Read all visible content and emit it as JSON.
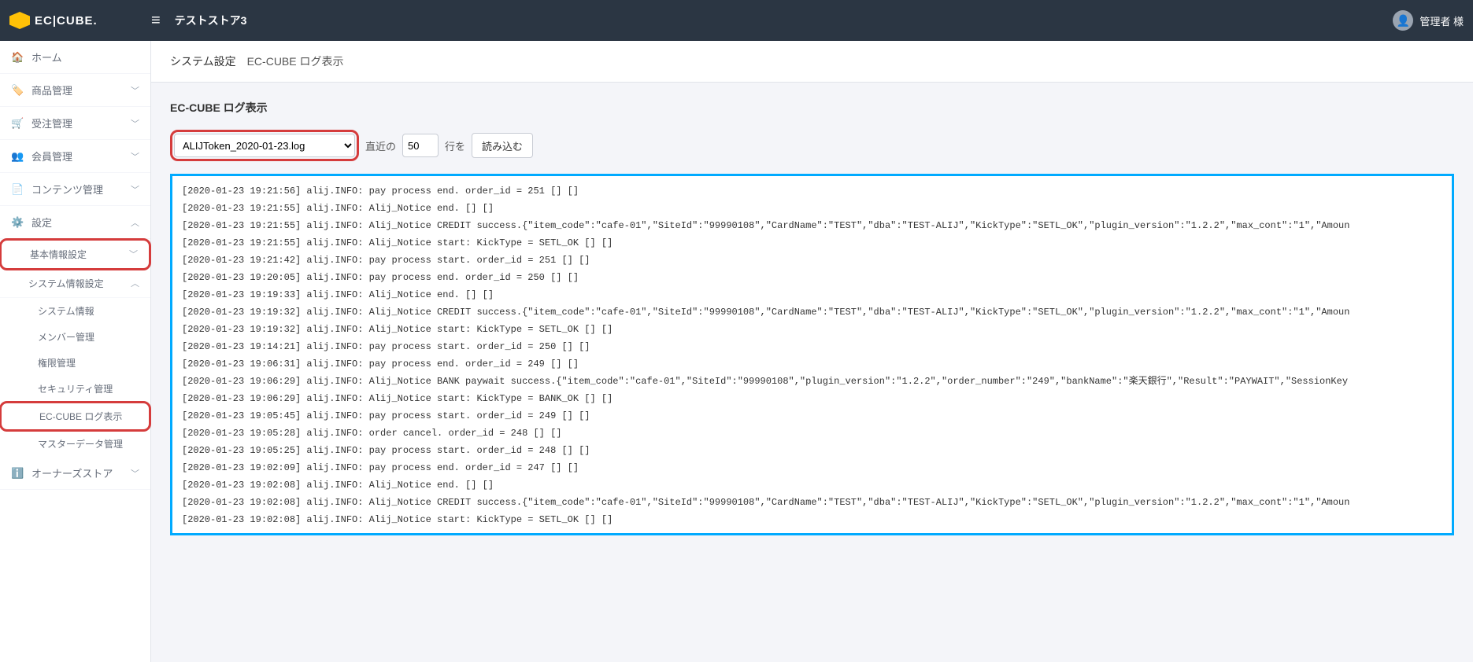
{
  "header": {
    "logo_text": "EC|CUBE.",
    "store_name": "テストストア3",
    "user_name": "管理者 様"
  },
  "sidebar": {
    "items": [
      {
        "icon": "🏠",
        "label": "ホーム"
      },
      {
        "icon": "🏷️",
        "label": "商品管理",
        "exp": true
      },
      {
        "icon": "🛒",
        "label": "受注管理",
        "exp": true
      },
      {
        "icon": "👥",
        "label": "会員管理",
        "exp": true
      },
      {
        "icon": "📄",
        "label": "コンテンツ管理",
        "exp": true
      },
      {
        "icon": "⚙️",
        "label": "設定",
        "exp": true,
        "open": true
      },
      {
        "icon": "ℹ️",
        "label": "オーナーズストア",
        "exp": true
      }
    ],
    "settings": {
      "basic_label": "基本情報設定",
      "sysinfo_label": "システム情報設定",
      "sub": [
        "システム情報",
        "メンバー管理",
        "権限管理",
        "セキュリティ管理",
        "EC-CUBE ログ表示",
        "マスターデータ管理"
      ]
    }
  },
  "breadcrumb": {
    "a": "システム設定",
    "b": "EC-CUBE ログ表示"
  },
  "panel": {
    "title": "EC-CUBE ログ表示",
    "file_selected": "ALIJToken_2020-01-23.log",
    "label_recent": "直近の",
    "line_count": "50",
    "label_lines": "行を",
    "load_btn": "読み込む"
  },
  "log_lines": [
    "[2020-01-23 19:21:56] alij.INFO: pay process end. order_id = 251 [] []",
    "[2020-01-23 19:21:55] alij.INFO: Alij_Notice end. [] []",
    "[2020-01-23 19:21:55] alij.INFO: Alij_Notice CREDIT success.{\"item_code\":\"cafe-01\",\"SiteId\":\"99990108\",\"CardName\":\"TEST\",\"dba\":\"TEST-ALIJ\",\"KickType\":\"SETL_OK\",\"plugin_version\":\"1.2.2\",\"max_cont\":\"1\",\"Amoun",
    "[2020-01-23 19:21:55] alij.INFO: Alij_Notice start: KickType = SETL_OK [] []",
    "[2020-01-23 19:21:42] alij.INFO: pay process start. order_id = 251 [] []",
    "[2020-01-23 19:20:05] alij.INFO: pay process end. order_id = 250 [] []",
    "[2020-01-23 19:19:33] alij.INFO: Alij_Notice end. [] []",
    "[2020-01-23 19:19:32] alij.INFO: Alij_Notice CREDIT success.{\"item_code\":\"cafe-01\",\"SiteId\":\"99990108\",\"CardName\":\"TEST\",\"dba\":\"TEST-ALIJ\",\"KickType\":\"SETL_OK\",\"plugin_version\":\"1.2.2\",\"max_cont\":\"1\",\"Amoun",
    "[2020-01-23 19:19:32] alij.INFO: Alij_Notice start: KickType = SETL_OK [] []",
    "[2020-01-23 19:14:21] alij.INFO: pay process start. order_id = 250 [] []",
    "[2020-01-23 19:06:31] alij.INFO: pay process end. order_id = 249 [] []",
    "[2020-01-23 19:06:29] alij.INFO: Alij_Notice BANK paywait success.{\"item_code\":\"cafe-01\",\"SiteId\":\"99990108\",\"plugin_version\":\"1.2.2\",\"order_number\":\"249\",\"bankName\":\"楽天銀行\",\"Result\":\"PAYWAIT\",\"SessionKey",
    "[2020-01-23 19:06:29] alij.INFO: Alij_Notice start: KickType = BANK_OK [] []",
    "[2020-01-23 19:05:45] alij.INFO: pay process start. order_id = 249 [] []",
    "[2020-01-23 19:05:28] alij.INFO: order cancel. order_id = 248 [] []",
    "[2020-01-23 19:05:25] alij.INFO: pay process start. order_id = 248 [] []",
    "[2020-01-23 19:02:09] alij.INFO: pay process end. order_id = 247 [] []",
    "[2020-01-23 19:02:08] alij.INFO: Alij_Notice end. [] []",
    "[2020-01-23 19:02:08] alij.INFO: Alij_Notice CREDIT success.{\"item_code\":\"cafe-01\",\"SiteId\":\"99990108\",\"CardName\":\"TEST\",\"dba\":\"TEST-ALIJ\",\"KickType\":\"SETL_OK\",\"plugin_version\":\"1.2.2\",\"max_cont\":\"1\",\"Amoun",
    "[2020-01-23 19:02:08] alij.INFO: Alij_Notice start: KickType = SETL_OK [] []"
  ]
}
